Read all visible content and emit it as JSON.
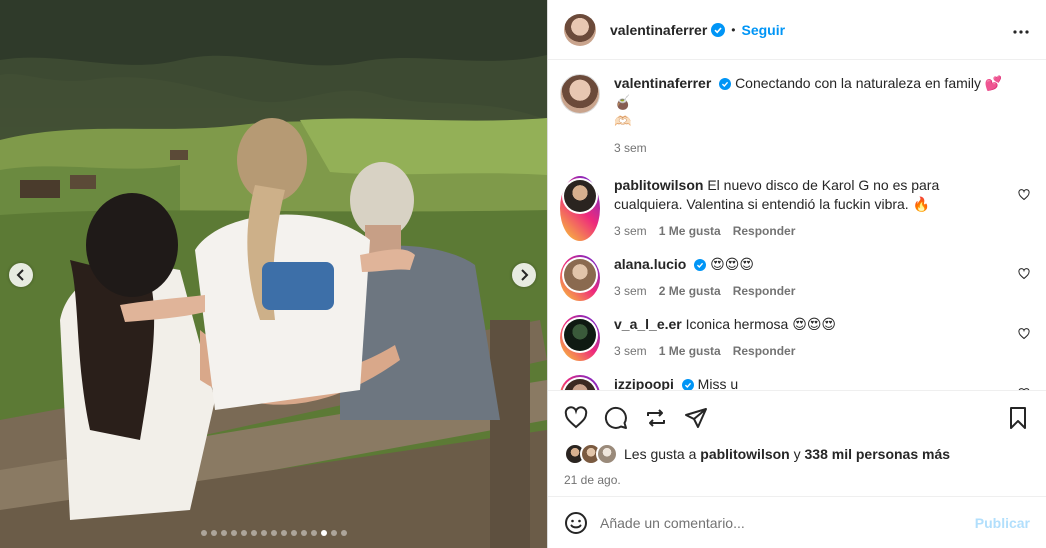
{
  "post": {
    "image_alt": "Familia sentada en un banco de madera mirando un valle verde",
    "carousel_total": 15,
    "carousel_active": 12
  },
  "author": {
    "username": "valentinaferrer",
    "follow_label": "Seguir",
    "separator": "•"
  },
  "caption": {
    "username": "valentinaferrer",
    "text": "Conectando con la naturaleza en family 💕🧉",
    "extra_emoji": "🫶🏻",
    "time": "3 sem"
  },
  "comments": [
    {
      "username": "pablitowilson",
      "verified": false,
      "text": "El nuevo disco de Karol G no es para cualquiera. Valentina si entendió la fuckin vibra. 🔥",
      "time": "3 sem",
      "likes": "1 Me gusta",
      "reply": "Responder"
    },
    {
      "username": "alana.lucio",
      "verified": true,
      "text": "😍😍😍",
      "time": "3 sem",
      "likes": "2 Me gusta",
      "reply": "Responder"
    },
    {
      "username": "v_a_l_e.er",
      "verified": false,
      "text": "Iconica hermosa 😍😍😍",
      "time": "3 sem",
      "likes": "1 Me gusta",
      "reply": "Responder"
    },
    {
      "username": "izzipoopi",
      "verified": true,
      "text": "Miss u",
      "time": "",
      "likes": "",
      "reply": ""
    }
  ],
  "likes_summary": {
    "prefix": "Les gusta a",
    "user": "pablitowilson",
    "connector": "y",
    "others": "338 mil personas más"
  },
  "date": "21 de ago.",
  "comment_input": {
    "placeholder": "Añade un comentario...",
    "publish_label": "Publicar"
  },
  "colors": {
    "accent": "#0095f6",
    "verified": "#0095f6",
    "publish_disabled": "#b2dffc",
    "muted": "#737373"
  }
}
